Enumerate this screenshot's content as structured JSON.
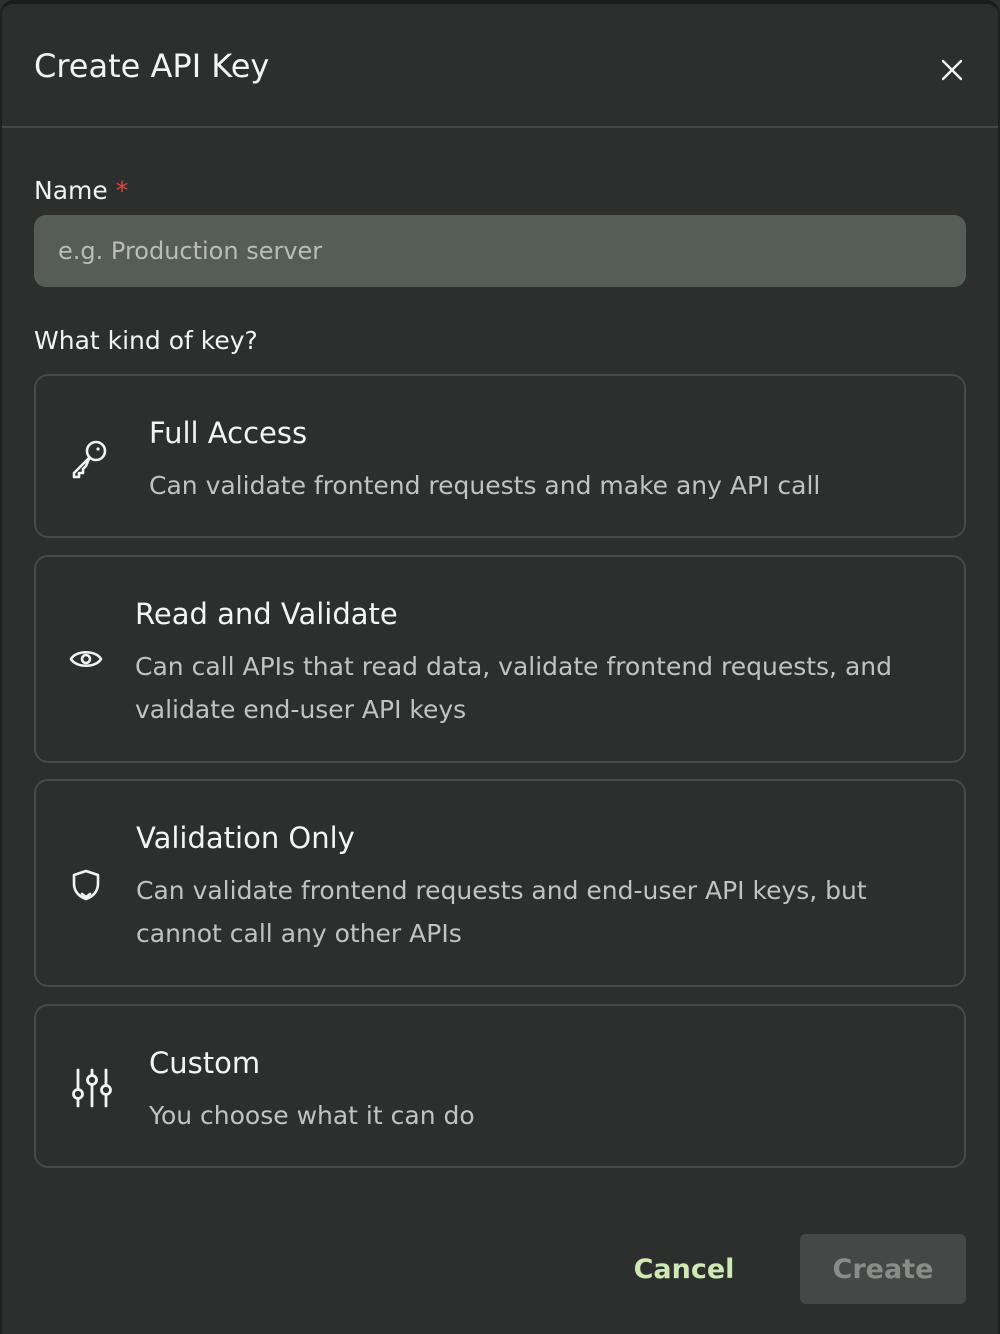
{
  "dialog": {
    "title": "Create API Key"
  },
  "name_field": {
    "label": "Name",
    "required_marker": "*",
    "placeholder": "e.g. Production server",
    "value": ""
  },
  "key_kind": {
    "label": "What kind of key?",
    "options": [
      {
        "icon": "key-icon",
        "title": "Full Access",
        "description": "Can validate frontend requests and make any API call"
      },
      {
        "icon": "eye-icon",
        "title": "Read and Validate",
        "description": "Can call APIs that read data, validate frontend requests, and validate end-user API keys"
      },
      {
        "icon": "shield-icon",
        "title": "Validation Only",
        "description": "Can validate frontend requests and end-user API keys, but cannot call any other APIs"
      },
      {
        "icon": "sliders-icon",
        "title": "Custom",
        "description": "You choose what it can do"
      }
    ]
  },
  "footer": {
    "cancel_label": "Cancel",
    "create_label": "Create"
  },
  "colors": {
    "background": "#2c2f2d",
    "input_background": "#565c58",
    "cancel_text": "#cfe8b4",
    "required_star": "#e0483e",
    "create_disabled_background": "#444846"
  }
}
